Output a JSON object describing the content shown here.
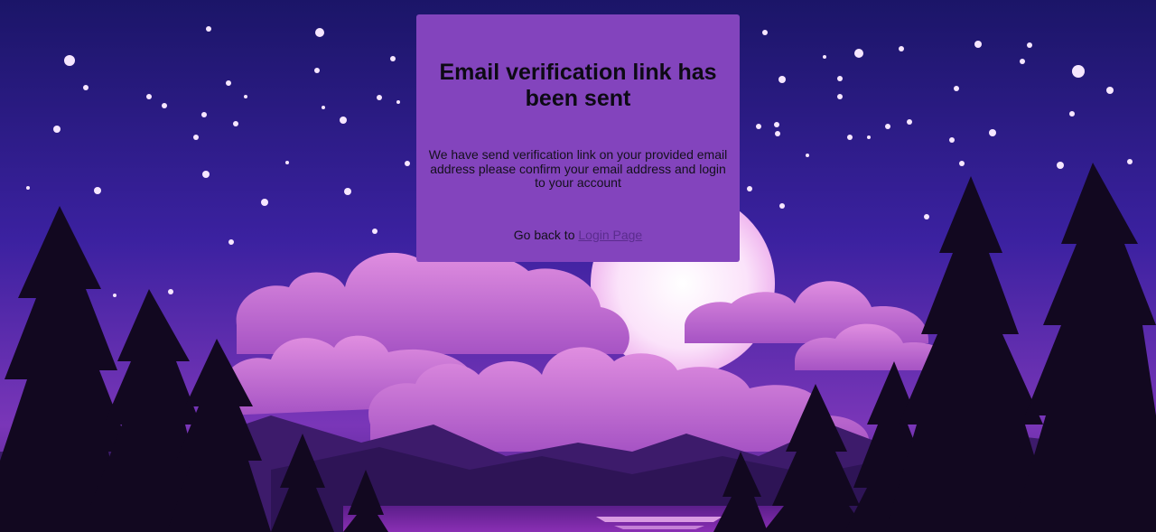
{
  "page": {
    "title": "Email verification link has been sent",
    "message": "We have send verification link on your provided email address please confirm your email address and login to your account",
    "go_back_text": "Go back to",
    "login_link_label": "Login Page"
  },
  "colors": {
    "card_background": "#8344bd",
    "sky_top": "#1d1670",
    "sky_bottom": "#6a2fb0",
    "moon": "#fbe8fb",
    "clouds": "#d67fd9",
    "trees": "#140a22",
    "link": "#5b2c8e"
  }
}
